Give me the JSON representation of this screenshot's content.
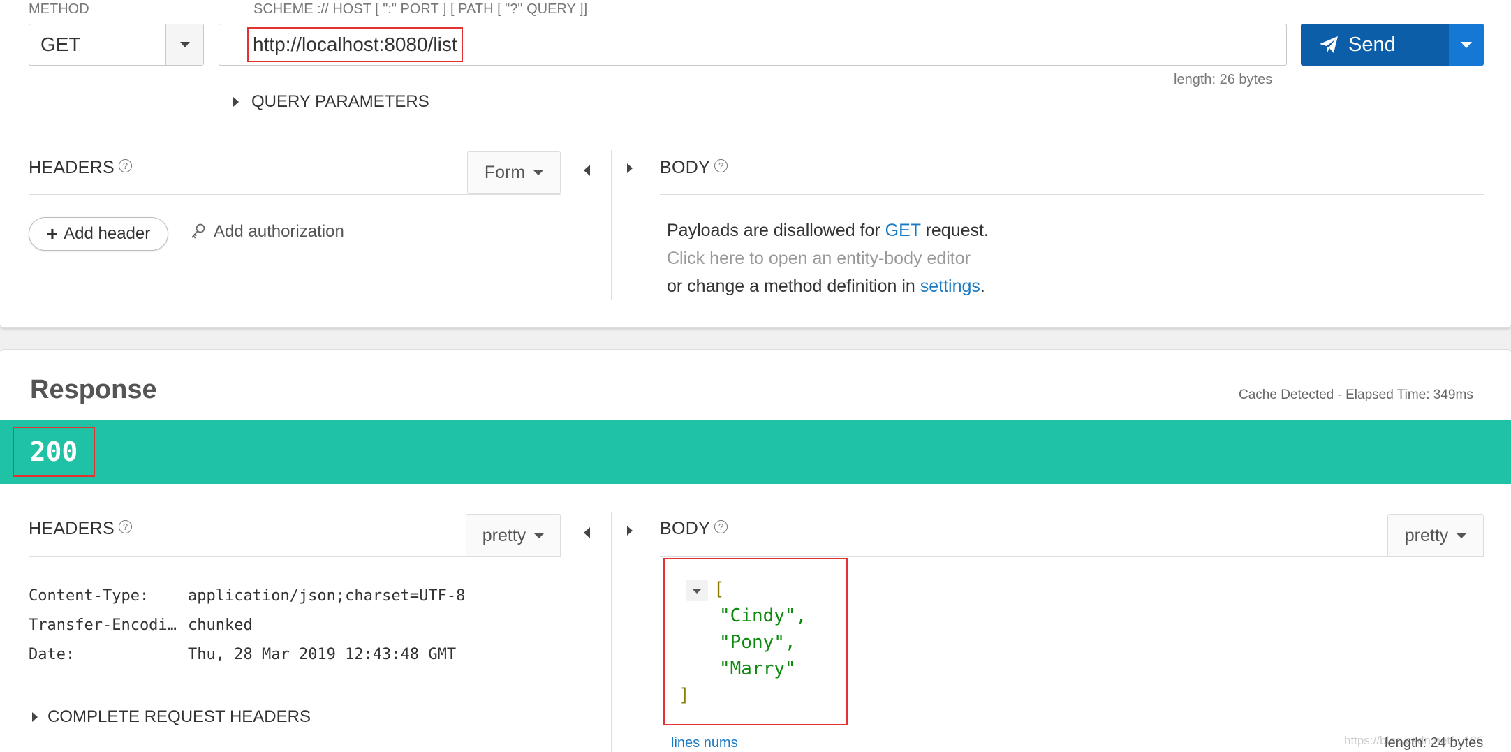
{
  "request": {
    "method_label": "METHOD",
    "method_value": "GET",
    "url_label": "SCHEME :// HOST [ \":\" PORT ] [ PATH [ \"?\" QUERY ]]",
    "url_value": "http://localhost:8080/list",
    "send_label": "Send",
    "url_length": "length: 26 bytes",
    "query_params_label": "QUERY PARAMETERS",
    "headers": {
      "title": "HEADERS",
      "mode": "Form",
      "add_header": "Add header",
      "add_authorization": "Add authorization"
    },
    "body": {
      "title": "BODY",
      "line1_prefix": "Payloads are disallowed for ",
      "line1_method": "GET",
      "line1_suffix": " request.",
      "line2": "Click here to open an entity-body editor",
      "line3_prefix": "or change a method definition in ",
      "line3_link": "settings",
      "line3_suffix": "."
    }
  },
  "response": {
    "title": "Response",
    "meta": "Cache Detected - Elapsed Time: 349ms",
    "status_code": "200",
    "headers": {
      "title": "HEADERS",
      "mode": "pretty",
      "rows": [
        {
          "name": "Content-Type:",
          "value": "application/json;charset=UTF-8"
        },
        {
          "name": "Transfer-Encodi…",
          "value": "chunked"
        },
        {
          "name": "Date:",
          "value": "Thu, 28 Mar 2019 12:43:48 GMT"
        }
      ],
      "complete_request_headers": "COMPLETE REQUEST HEADERS"
    },
    "body": {
      "title": "BODY",
      "mode": "pretty",
      "open_bracket": "[",
      "items": [
        "\"Cindy\",",
        "\"Pony\",",
        "\"Marry\""
      ],
      "close_bracket": "]",
      "lines_nums": "lines nums",
      "length": "length: 24 bytes"
    }
  },
  "watermark": "https://blog.csdn.net/...126",
  "colors": {
    "status_bar": "#1fc2a4",
    "send_button": "#0c5ea8",
    "highlight_box": "#e23232",
    "link": "#1a7bc4"
  }
}
